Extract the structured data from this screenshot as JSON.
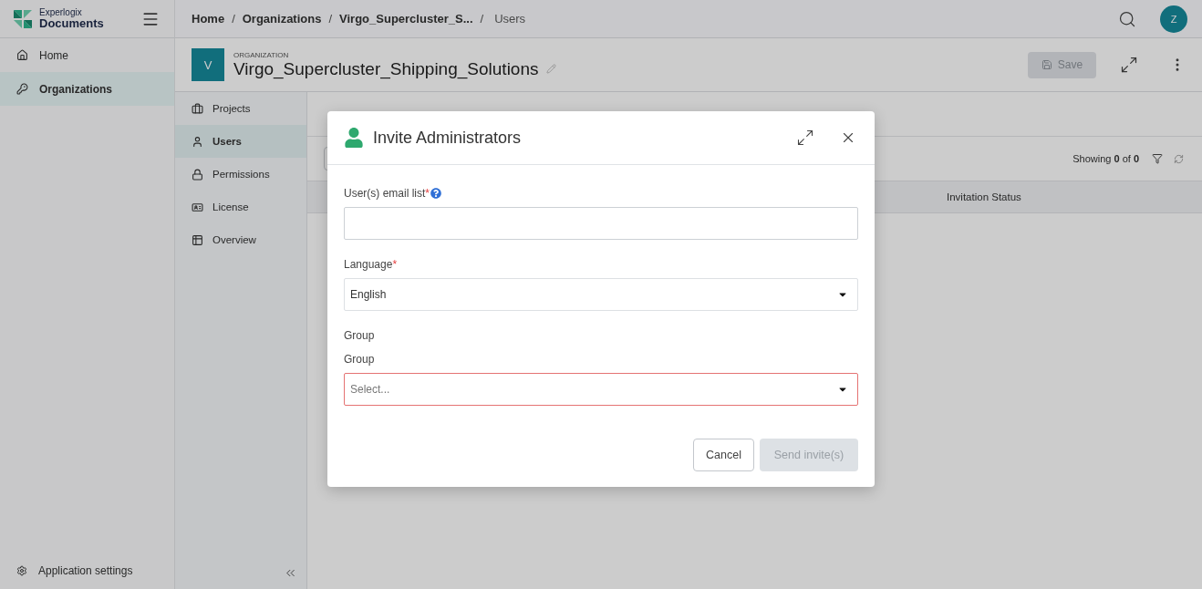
{
  "sidebar": {
    "logo": {
      "top": "Experlogix",
      "name": "Documents"
    },
    "items": [
      {
        "label": "Home",
        "selected": false
      },
      {
        "label": "Organizations",
        "selected": true
      }
    ],
    "footer": {
      "label": "Application settings"
    }
  },
  "breadcrumbs": [
    {
      "label": "Home",
      "current": false
    },
    {
      "separator": "/",
      "label": "Organizations",
      "current": false
    },
    {
      "separator": "/",
      "label": "Virgo_Supercluster_S...",
      "current": false
    },
    {
      "separator": "/",
      "label": "Users",
      "current": true
    }
  ],
  "avatar": "Z",
  "organization": {
    "initial": "V",
    "caption": "ORGANIZATION",
    "name": "Virgo_Supercluster_Shipping_Solutions"
  },
  "save_button": {
    "label": "Save",
    "disabled": true
  },
  "subnav": [
    {
      "label": "Projects",
      "selected": false
    },
    {
      "label": "Users",
      "selected": true
    },
    {
      "label": "Permissions",
      "selected": false
    },
    {
      "label": "License",
      "selected": false
    },
    {
      "label": "Overview",
      "selected": false
    }
  ],
  "content": {
    "showing": "Showing **0** of **0**",
    "columns": [
      "Invitation Status"
    ]
  },
  "modal": {
    "title": "Invite Administrators",
    "fields": [
      {
        "kind": "text",
        "label": "User(s) email list",
        "required_mark": "*",
        "help": true,
        "invalid": false
      },
      {
        "kind": "select",
        "label": "Language",
        "required_mark": "*",
        "value": "English",
        "invalid": false
      },
      {
        "kind": "select",
        "section": "Group",
        "label": "Group",
        "placeholder": "Select...",
        "invalid": true
      }
    ],
    "buttons": [
      {
        "kind": "secondary",
        "label": "Cancel"
      },
      {
        "kind": "primary",
        "label": "Send invite(s)",
        "disabled": true
      }
    ]
  }
}
